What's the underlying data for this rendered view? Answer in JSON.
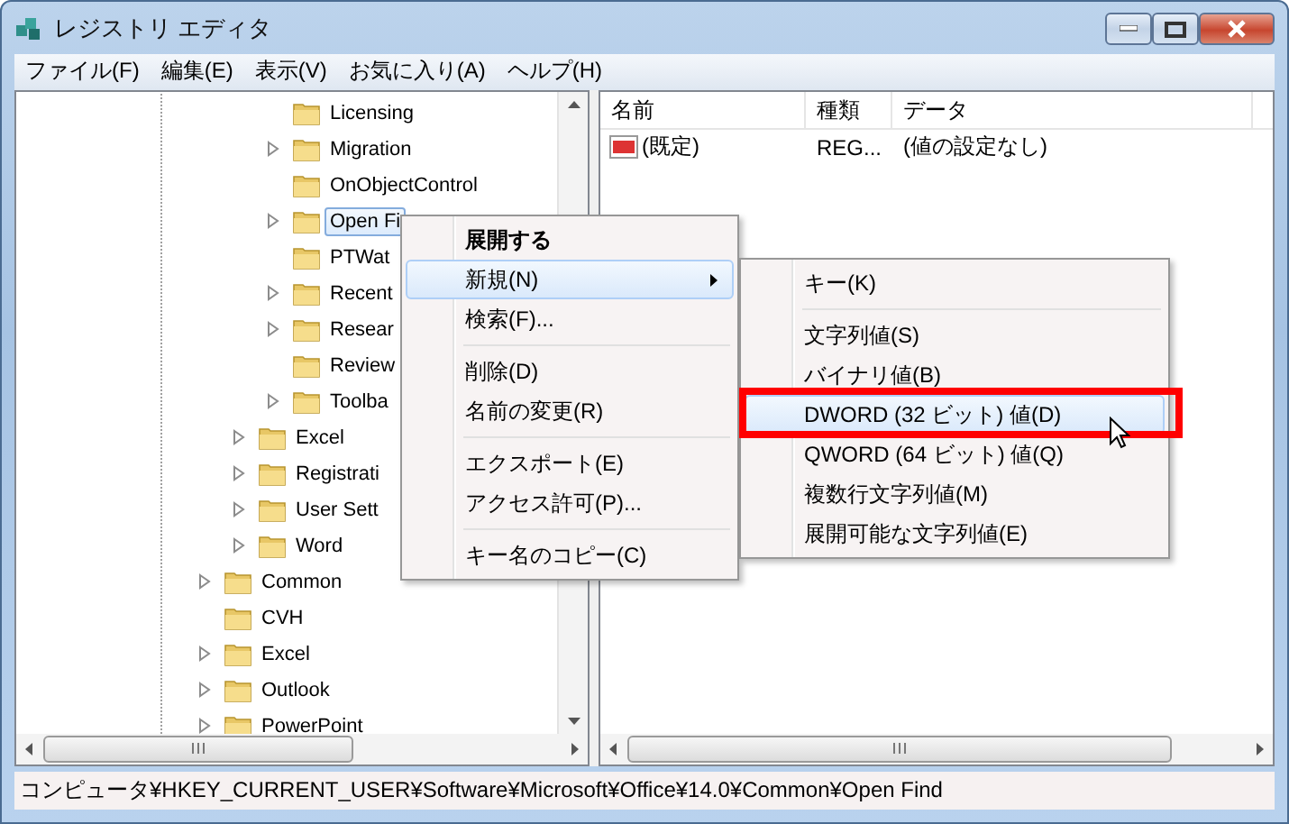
{
  "window": {
    "title": "レジストリ エディタ"
  },
  "menu_bar": [
    "ファイル(F)",
    "編集(E)",
    "表示(V)",
    "お気に入り(A)",
    "ヘルプ(H)"
  ],
  "tree": [
    {
      "children": [
        {
          "children": [
            {
              "label": "Licensing",
              "expandable": false,
              "selected": false
            },
            {
              "label": "Migration",
              "expandable": true,
              "selected": false
            },
            {
              "label": "OnObjectControl",
              "expandable": false,
              "selected": false
            },
            {
              "label": "Open Fi",
              "expandable": true,
              "selected": true
            },
            {
              "label": "PTWat",
              "expandable": false,
              "selected": false
            },
            {
              "label": "Recent",
              "expandable": true,
              "selected": false
            },
            {
              "label": "Resear",
              "expandable": true,
              "selected": false
            },
            {
              "label": "Review",
              "expandable": false,
              "selected": false
            },
            {
              "label": "Toolba",
              "expandable": true,
              "selected": false
            }
          ]
        },
        {
          "label": "Excel",
          "expandable": true,
          "selected": false
        },
        {
          "label": "Registrati",
          "expandable": true,
          "selected": false
        },
        {
          "label": "User Sett",
          "expandable": true,
          "selected": false
        },
        {
          "label": "Word",
          "expandable": true,
          "selected": false
        }
      ]
    },
    {
      "label": "Common",
      "expandable": true,
      "selected": false
    },
    {
      "label": "CVH",
      "expandable": false,
      "selected": false
    },
    {
      "label": "Excel",
      "expandable": true,
      "selected": false
    },
    {
      "label": "Outlook",
      "expandable": true,
      "selected": false
    },
    {
      "label": "PowerPoint",
      "expandable": true,
      "selected": false
    }
  ],
  "values_list": {
    "columns": [
      "名前",
      "種類",
      "データ"
    ],
    "rows": [
      {
        "name": "(既定)",
        "type": "REG...",
        "data": "(値の設定なし)"
      }
    ]
  },
  "context_menu": [
    {
      "kind": "item",
      "label": "展開する",
      "default": true,
      "selected": false
    },
    {
      "kind": "item",
      "label": "新規(N)",
      "submenu": true,
      "selected": true
    },
    {
      "kind": "item",
      "label": "検索(F)...",
      "selected": false
    },
    {
      "kind": "separator"
    },
    {
      "kind": "item",
      "label": "削除(D)",
      "selected": false
    },
    {
      "kind": "item",
      "label": "名前の変更(R)",
      "selected": false
    },
    {
      "kind": "separator"
    },
    {
      "kind": "item",
      "label": "エクスポート(E)",
      "selected": false
    },
    {
      "kind": "item",
      "label": "アクセス許可(P)...",
      "selected": false
    },
    {
      "kind": "separator"
    },
    {
      "kind": "item",
      "label": "キー名のコピー(C)",
      "selected": false
    }
  ],
  "submenu": [
    {
      "kind": "item",
      "label": "キー(K)",
      "selected": false
    },
    {
      "kind": "separator"
    },
    {
      "kind": "item",
      "label": "文字列値(S)",
      "selected": false
    },
    {
      "kind": "item",
      "label": "バイナリ値(B)",
      "selected": false
    },
    {
      "kind": "item",
      "label": "DWORD (32 ビット) 値(D)",
      "selected": true
    },
    {
      "kind": "item",
      "label": "QWORD (64 ビット) 値(Q)",
      "selected": false
    },
    {
      "kind": "item",
      "label": "複数行文字列値(M)",
      "selected": false
    },
    {
      "kind": "item",
      "label": "展開可能な文字列値(E)",
      "selected": false
    }
  ],
  "status_bar": "コンピュータ¥HKEY_CURRENT_USER¥Software¥Microsoft¥Office¥14.0¥Common¥Open Find"
}
